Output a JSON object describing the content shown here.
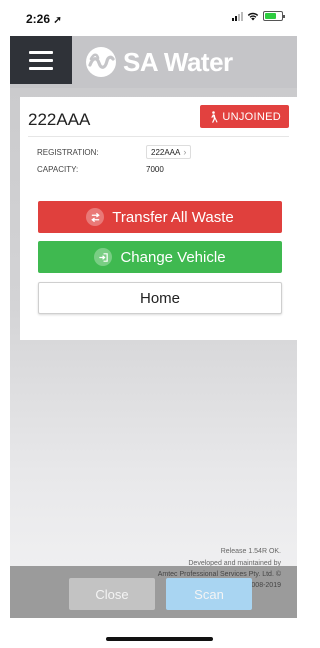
{
  "status_bar": {
    "time": "2:26",
    "location_arrow": "➚"
  },
  "header": {
    "brand": "SA Water",
    "menu_icon": "hamburger-icon",
    "logo_icon": "sa-water-logo"
  },
  "vehicle": {
    "registration_title": "222AAA",
    "status_badge": "UNJOINED",
    "details": {
      "registration_label": "REGISTRATION:",
      "registration_value": "222AAA",
      "capacity_label": "CAPACITY:",
      "capacity_value": "7000"
    }
  },
  "actions": {
    "transfer_label": "Transfer All Waste",
    "change_vehicle_label": "Change Vehicle",
    "home_label": "Home"
  },
  "footer": {
    "release": "Release 1.54R OK.",
    "developed_line": "Developed and maintained by",
    "company_line": "Amtec Professional Services Pty. Ltd. ©",
    "year_line": "2008-2019"
  },
  "bottom_bar": {
    "close_label": "Close",
    "scan_label": "Scan"
  },
  "colors": {
    "red": "#e0403d",
    "green": "#3fb950",
    "menu_dark": "#2f3238",
    "scan_blue": "#a9d5f2"
  }
}
